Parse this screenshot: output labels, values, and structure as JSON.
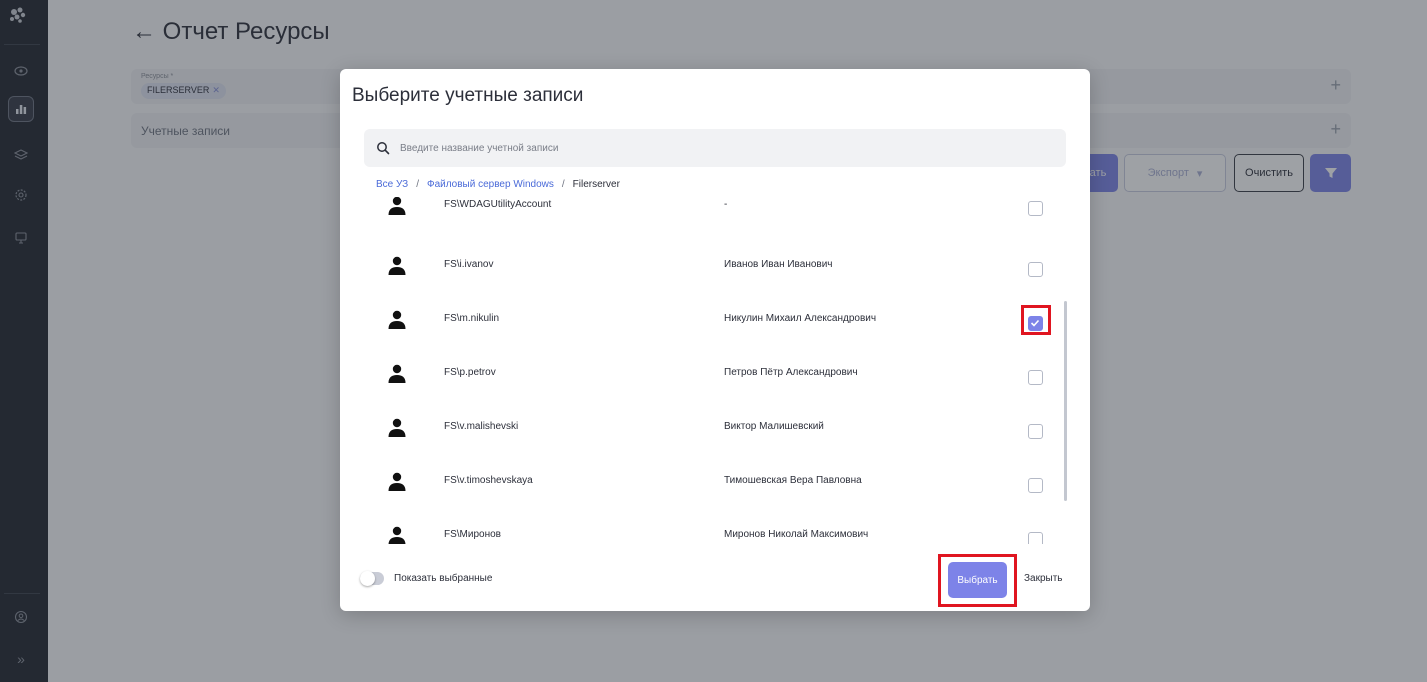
{
  "page": {
    "title": "← Отчет Ресурсы",
    "resources_field": {
      "label": "Ресурсы *",
      "chip": "FILERSERVER",
      "chip_remove": "✕"
    },
    "accounts_field": {
      "label": "Учетные записи"
    },
    "plus_symbol": "+",
    "toolbar": {
      "build_label_partial": "ать",
      "export_label": "Экспорт",
      "export_chevron": "▾",
      "clear_label": "Очистить"
    }
  },
  "sidebar": {
    "icons": [
      "eye-icon",
      "bar-chart-icon",
      "layers-icon",
      "settings-icon",
      "monitor-icon",
      "user-icon",
      "expand-icon"
    ],
    "expand_glyph": "»"
  },
  "modal": {
    "title": "Выберите учетные записи",
    "search": {
      "placeholder": "Введите название учетной записи",
      "value": ""
    },
    "breadcrumb": {
      "items": [
        "Все УЗ",
        "Файловый сервер Windows",
        "Filerserver"
      ],
      "separator": "/"
    },
    "accounts": [
      {
        "login": "FS\\WDAGUtilityAccount",
        "full_name": "-",
        "checked": false
      },
      {
        "login": "FS\\i.ivanov",
        "full_name": "Иванов Иван Иванович",
        "checked": false
      },
      {
        "login": "FS\\m.nikulin",
        "full_name": "Никулин Михаил Александрович",
        "checked": true
      },
      {
        "login": "FS\\p.petrov",
        "full_name": "Петров Пётр Александрович",
        "checked": false
      },
      {
        "login": "FS\\v.malishevski",
        "full_name": "Виктор Малишевский",
        "checked": false
      },
      {
        "login": "FS\\v.timoshevskaya",
        "full_name": "Тимошевская Вера Павловна",
        "checked": false
      },
      {
        "login": "FS\\Миронов",
        "full_name": "Миронов Николай Максимович",
        "checked": false
      }
    ],
    "show_selected_label": "Показать выбранные",
    "show_selected_on": false,
    "select_label": "Выбрать",
    "close_label": "Закрыть"
  },
  "colors": {
    "accent": "#7d83e8",
    "highlight": "#e01520",
    "sidebar": "#21252e"
  }
}
